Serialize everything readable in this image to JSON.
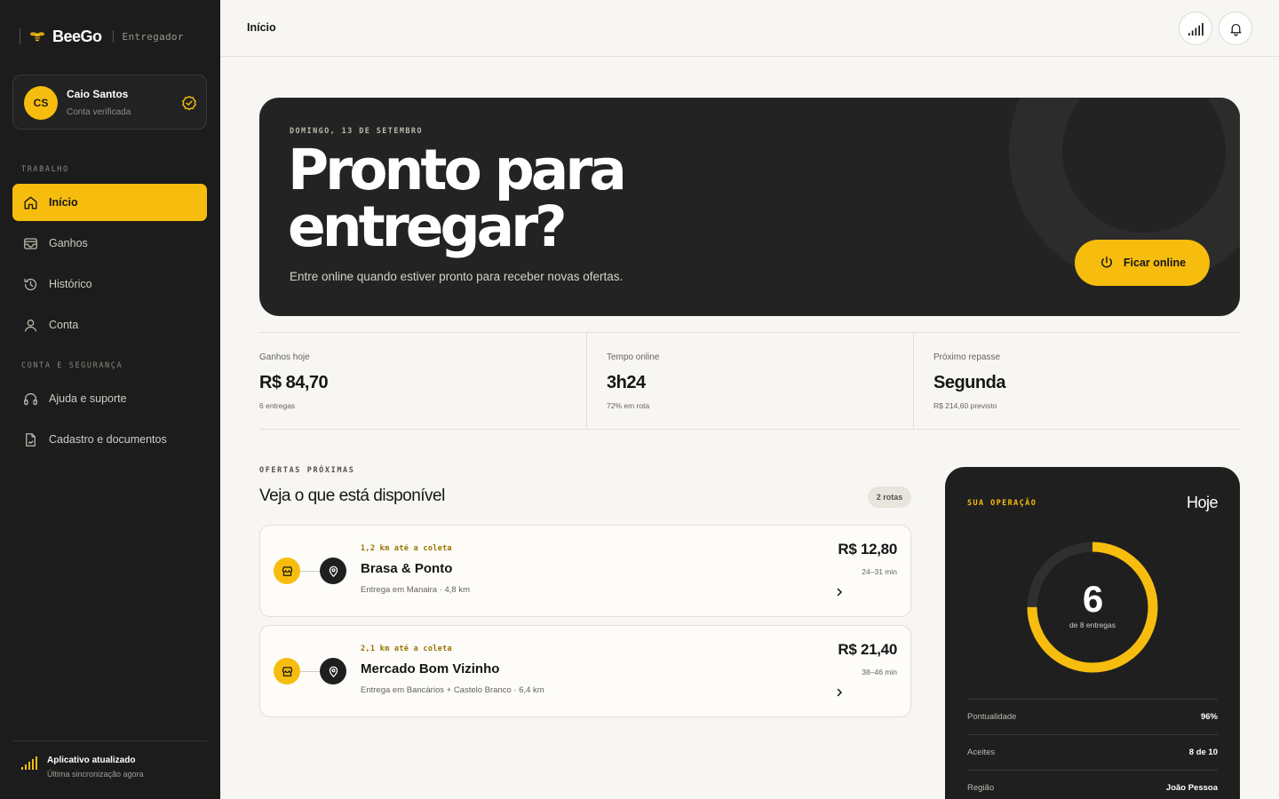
{
  "brand": {
    "name": "BeeGo",
    "role": "Entregador"
  },
  "profile": {
    "initials": "CS",
    "name": "Caio Santos",
    "status": "Conta verificada"
  },
  "sidebar": {
    "section_work": "TRABALHO",
    "section_account": "CONTA E SEGURANÇA",
    "items": [
      {
        "label": "Início",
        "icon": "home-icon",
        "active": true
      },
      {
        "label": "Ganhos",
        "icon": "wallet-icon"
      },
      {
        "label": "Histórico",
        "icon": "history-icon"
      },
      {
        "label": "Conta",
        "icon": "user-icon"
      },
      {
        "label": "Ajuda e suporte",
        "icon": "headset-icon"
      },
      {
        "label": "Cadastro e documentos",
        "icon": "document-icon"
      }
    ],
    "sync_title": "Aplicativo atualizado",
    "sync_sub": "Última sincronização agora"
  },
  "topbar": {
    "title": "Início",
    "icons": [
      "signal-icon",
      "bell-icon"
    ]
  },
  "hero": {
    "date": "DOMINGO, 13 DE SETEMBRO",
    "headline": "Pronto para entregar?",
    "subtitle": "Entre online quando estiver pronto para receber novas ofertas.",
    "button": "Ficar online"
  },
  "stats": [
    {
      "label": "Ganhos hoje",
      "value": "R$ 84,70",
      "note": "6 entregas"
    },
    {
      "label": "Tempo online",
      "value": "3h24",
      "note": "72% em rota"
    },
    {
      "label": "Próximo repasse",
      "value": "Segunda",
      "note": "R$ 214,60 previsto"
    }
  ],
  "offers": {
    "label": "OFERTAS PRÓXIMAS",
    "title": "Veja o que está disponível",
    "count": "2 rotas",
    "items": [
      {
        "distance": "1,2 km até a coleta",
        "name": "Brasa & Ponto",
        "description": "Entrega em Manaira · 4,8 km",
        "price": "R$ 12,80",
        "eta": "24–31 min"
      },
      {
        "distance": "2,1 km até a coleta",
        "name": "Mercado Bom Vizinho",
        "description": "Entrega em Bancários + Castelo Branco · 6,4 km",
        "price": "R$ 21,40",
        "eta": "38–46 min"
      }
    ]
  },
  "operation": {
    "label": "SUA OPERAÇÃO",
    "period": "Hoje",
    "completed": "6",
    "progress_fraction": 0.75,
    "subtitle": "de 8 entregas",
    "rows": [
      {
        "key": "Pontualidade",
        "value": "96%"
      },
      {
        "key": "Aceites",
        "value": "8 de 10"
      },
      {
        "key": "Região",
        "value": "João Pessoa"
      }
    ]
  },
  "colors": {
    "accent": "#f7bd0e",
    "dark": "#1c1c1c",
    "background": "#f7f6f2"
  }
}
